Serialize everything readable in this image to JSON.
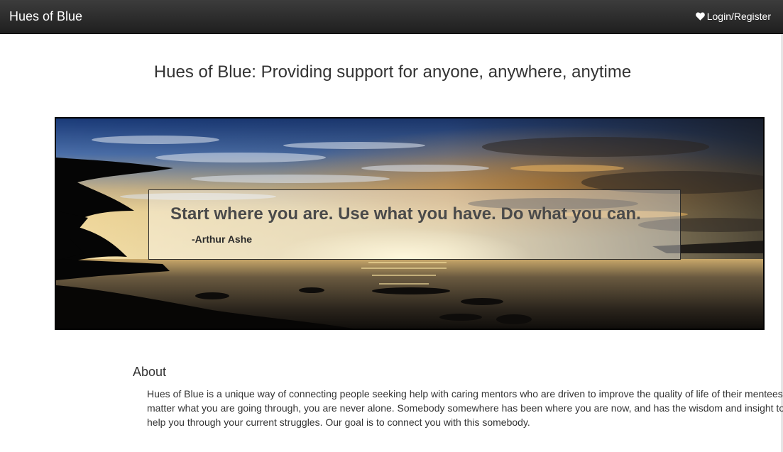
{
  "navbar": {
    "brand": "Hues of Blue",
    "login_label": "Login/Register",
    "login_icon": "heart-icon"
  },
  "main": {
    "headline": "Hues of Blue: Providing support for anyone, anywhere, anytime"
  },
  "hero": {
    "quote": "Start where you are. Use what you have. Do what you can.",
    "author": "-Arthur Ashe"
  },
  "about": {
    "title": "About",
    "lines": [
      "Hues of Blue is a unique way of connecting people seeking help with caring mentors who are driven to improve the quality of life of their mentees. No",
      "matter what you are going through, you are never alone. Somebody somewhere has been where you are now, and has the wisdom and insight to",
      "help you through your current struggles. Our goal is to connect you with this somebody."
    ]
  },
  "colors": {
    "navbar": "#2a2a2a",
    "text": "#333333",
    "quote_text": "#4a4a4a"
  }
}
